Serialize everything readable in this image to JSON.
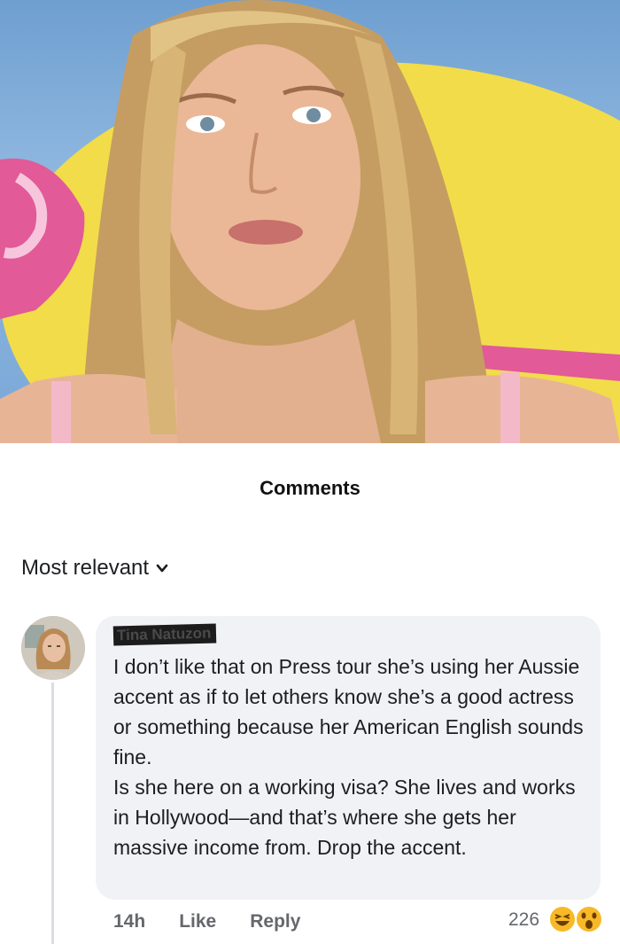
{
  "photo": {
    "subject": "Woman with long blonde hair in front of a pink and yellow background"
  },
  "sheet": {
    "title": "Comments"
  },
  "sort": {
    "label": "Most relevant"
  },
  "comment": {
    "author": "Tina Natuzon",
    "paragraphs": [
      "I don’t like that on Press tour she’s using her Aussie accent as if to let others know she’s a good actress or something because her American English sounds fine.",
      "Is she here on a working visa? She lives and works in Hollywood—and that’s where she gets her massive income from. Drop the accent."
    ],
    "time": "14h",
    "like_label": "Like",
    "reply_label": "Reply",
    "reaction_count": "226",
    "reactions": [
      "haha-icon",
      "wow-icon"
    ]
  },
  "colors": {
    "bubble": "#f0f2f5",
    "muted_text": "#65676b",
    "text": "#1c1e21",
    "reaction_yellow": "#f7b928"
  }
}
